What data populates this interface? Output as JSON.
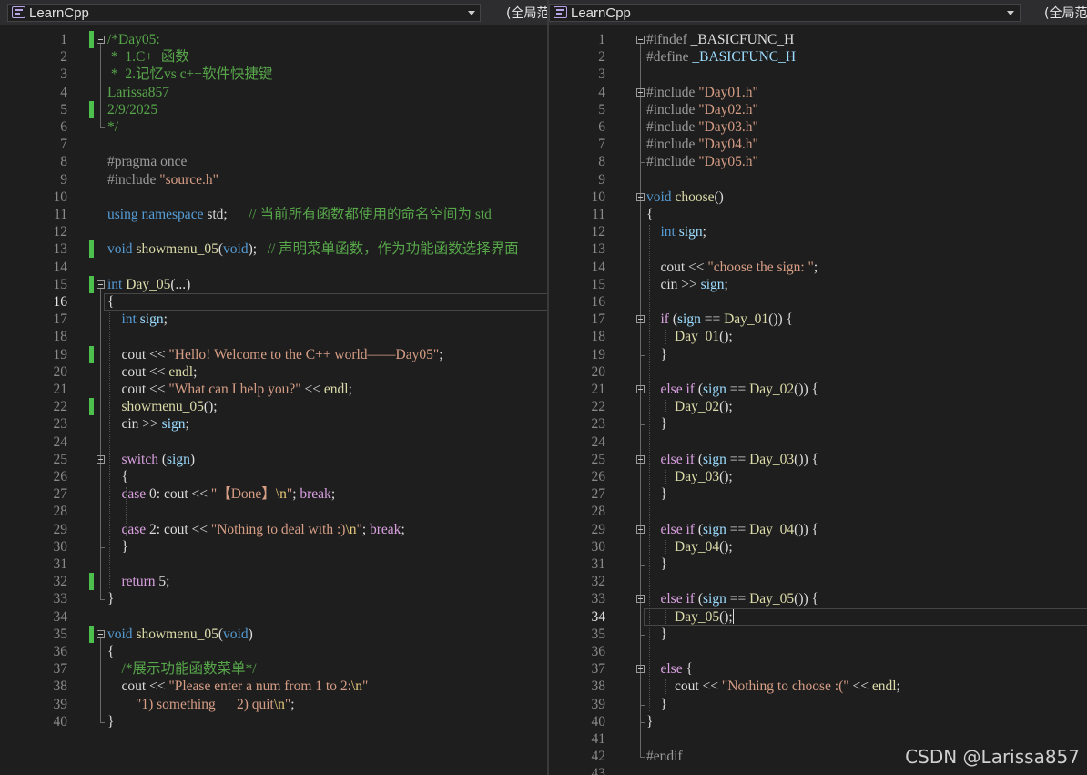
{
  "left_pane": {
    "project": "LearnCpp",
    "scope": "(全局范",
    "current_line": 16,
    "lines": [
      {
        "n": "1",
        "t": [
          [
            "c",
            "/*Day05:"
          ]
        ]
      },
      {
        "n": "2",
        "t": [
          [
            "c",
            " *  1.C++函数"
          ]
        ]
      },
      {
        "n": "3",
        "t": [
          [
            "c",
            " *  2.记忆vs c++软件快捷键"
          ]
        ]
      },
      {
        "n": "4",
        "t": [
          [
            "c",
            "Larissa857"
          ]
        ]
      },
      {
        "n": "5",
        "t": [
          [
            "c",
            "2/9/2025"
          ]
        ]
      },
      {
        "n": "6",
        "t": [
          [
            "c",
            "*/"
          ]
        ]
      },
      {
        "n": "7",
        "t": []
      },
      {
        "n": "8",
        "t": [
          [
            "p",
            "#pragma once"
          ]
        ]
      },
      {
        "n": "9",
        "t": [
          [
            "p",
            "#include "
          ],
          [
            "s",
            "\"source.h\""
          ]
        ]
      },
      {
        "n": "10",
        "t": []
      },
      {
        "n": "11",
        "t": [
          [
            "k",
            "using namespace "
          ],
          [
            "n",
            "std;      "
          ],
          [
            "c",
            "// 当前所有函数都使用的命名空间为 std"
          ]
        ]
      },
      {
        "n": "12",
        "t": []
      },
      {
        "n": "13",
        "t": [
          [
            "k",
            "void "
          ],
          [
            "f",
            "showmenu_05"
          ],
          [
            "n",
            "("
          ],
          [
            "k",
            "void"
          ],
          [
            "n",
            ");   "
          ],
          [
            "c",
            "// 声明菜单函数，作为功能函数选择界面"
          ]
        ]
      },
      {
        "n": "14",
        "t": []
      },
      {
        "n": "15",
        "t": [
          [
            "k",
            "int "
          ],
          [
            "f",
            "Day_05"
          ],
          [
            "n",
            "(...)"
          ]
        ]
      },
      {
        "n": "16",
        "t": [
          [
            "n",
            "{"
          ]
        ]
      },
      {
        "n": "17",
        "t": [
          [
            "n",
            "    "
          ],
          [
            "k",
            "int "
          ],
          [
            "v",
            "sign"
          ],
          [
            "n",
            ";"
          ]
        ]
      },
      {
        "n": "18",
        "t": []
      },
      {
        "n": "19",
        "t": [
          [
            "n",
            "    cout << "
          ],
          [
            "s",
            "\"Hello! Welcome to the C++ world——Day05\""
          ],
          [
            "n",
            ";"
          ]
        ]
      },
      {
        "n": "20",
        "t": [
          [
            "n",
            "    cout << "
          ],
          [
            "f",
            "endl"
          ],
          [
            "n",
            ";"
          ]
        ]
      },
      {
        "n": "21",
        "t": [
          [
            "n",
            "    cout << "
          ],
          [
            "s",
            "\"What can I help you?\""
          ],
          [
            "n",
            " << "
          ],
          [
            "f",
            "endl"
          ],
          [
            "n",
            ";"
          ]
        ]
      },
      {
        "n": "22",
        "t": [
          [
            "n",
            "    "
          ],
          [
            "f",
            "showmenu_05"
          ],
          [
            "n",
            "();"
          ]
        ]
      },
      {
        "n": "23",
        "t": [
          [
            "n",
            "    cin >> "
          ],
          [
            "v",
            "sign"
          ],
          [
            "n",
            ";"
          ]
        ]
      },
      {
        "n": "24",
        "t": []
      },
      {
        "n": "25",
        "t": [
          [
            "n",
            "    "
          ],
          [
            "r",
            "switch "
          ],
          [
            "n",
            "("
          ],
          [
            "v",
            "sign"
          ],
          [
            "n",
            ")"
          ]
        ]
      },
      {
        "n": "26",
        "t": [
          [
            "n",
            "    {"
          ]
        ]
      },
      {
        "n": "27",
        "t": [
          [
            "n",
            "    "
          ],
          [
            "r",
            "case "
          ],
          [
            "n",
            "0: cout << "
          ],
          [
            "s",
            "\"【Done】"
          ],
          [
            "e",
            "\\n"
          ],
          [
            "s",
            "\""
          ],
          [
            "n",
            "; "
          ],
          [
            "r",
            "break"
          ],
          [
            "n",
            ";"
          ]
        ]
      },
      {
        "n": "28",
        "t": []
      },
      {
        "n": "29",
        "t": [
          [
            "n",
            "    "
          ],
          [
            "r",
            "case "
          ],
          [
            "n",
            "2: cout << "
          ],
          [
            "s",
            "\"Nothing to deal with :)"
          ],
          [
            "e",
            "\\n"
          ],
          [
            "s",
            "\""
          ],
          [
            "n",
            "; "
          ],
          [
            "r",
            "break"
          ],
          [
            "n",
            ";"
          ]
        ]
      },
      {
        "n": "30",
        "t": [
          [
            "n",
            "    }"
          ]
        ]
      },
      {
        "n": "31",
        "t": []
      },
      {
        "n": "32",
        "t": [
          [
            "n",
            "    "
          ],
          [
            "r",
            "return "
          ],
          [
            "n",
            "5;"
          ]
        ]
      },
      {
        "n": "33",
        "t": [
          [
            "n",
            "}"
          ]
        ]
      },
      {
        "n": "34",
        "t": []
      },
      {
        "n": "35",
        "t": [
          [
            "k",
            "void "
          ],
          [
            "f",
            "showmenu_05"
          ],
          [
            "n",
            "("
          ],
          [
            "k",
            "void"
          ],
          [
            "n",
            ")"
          ]
        ]
      },
      {
        "n": "36",
        "t": [
          [
            "n",
            "{"
          ]
        ]
      },
      {
        "n": "37",
        "t": [
          [
            "n",
            "    "
          ],
          [
            "c",
            "/*展示功能函数菜单*/"
          ]
        ]
      },
      {
        "n": "38",
        "t": [
          [
            "n",
            "    cout << "
          ],
          [
            "s",
            "\"Please enter a num from 1 to 2:"
          ],
          [
            "e",
            "\\n"
          ],
          [
            "s",
            "\""
          ]
        ]
      },
      {
        "n": "39",
        "t": [
          [
            "s",
            "        \"1) something      2) quit"
          ],
          [
            "e",
            "\\n"
          ],
          [
            "s",
            "\""
          ],
          [
            "n",
            ";"
          ]
        ]
      },
      {
        "n": "40",
        "t": [
          [
            "n",
            "}"
          ]
        ]
      }
    ]
  },
  "right_pane": {
    "project": "LearnCpp",
    "scope": "(全局范",
    "current_line": 34,
    "lines": [
      {
        "n": "1",
        "t": [
          [
            "p",
            "#ifndef "
          ],
          [
            "n",
            "_BASICFUNC_H"
          ]
        ]
      },
      {
        "n": "2",
        "t": [
          [
            "p",
            "#define "
          ],
          [
            "v",
            "_BASICFUNC_H"
          ]
        ]
      },
      {
        "n": "3",
        "t": []
      },
      {
        "n": "4",
        "t": [
          [
            "p",
            "#include "
          ],
          [
            "s",
            "\"Day01.h\""
          ]
        ]
      },
      {
        "n": "5",
        "t": [
          [
            "p",
            "#include "
          ],
          [
            "s",
            "\"Day02.h\""
          ]
        ]
      },
      {
        "n": "6",
        "t": [
          [
            "p",
            "#include "
          ],
          [
            "s",
            "\"Day03.h\""
          ]
        ]
      },
      {
        "n": "7",
        "t": [
          [
            "p",
            "#include "
          ],
          [
            "s",
            "\"Day04.h\""
          ]
        ]
      },
      {
        "n": "8",
        "t": [
          [
            "p",
            "#include "
          ],
          [
            "s",
            "\"Day05.h\""
          ]
        ]
      },
      {
        "n": "9",
        "t": []
      },
      {
        "n": "10",
        "t": [
          [
            "k",
            "void "
          ],
          [
            "f",
            "choose"
          ],
          [
            "n",
            "()"
          ]
        ]
      },
      {
        "n": "11",
        "t": [
          [
            "n",
            "{"
          ]
        ]
      },
      {
        "n": "12",
        "t": [
          [
            "n",
            "    "
          ],
          [
            "k",
            "int "
          ],
          [
            "v",
            "sign"
          ],
          [
            "n",
            ";"
          ]
        ]
      },
      {
        "n": "13",
        "t": []
      },
      {
        "n": "14",
        "t": [
          [
            "n",
            "    cout << "
          ],
          [
            "s",
            "\"choose the sign: \""
          ],
          [
            "n",
            ";"
          ]
        ]
      },
      {
        "n": "15",
        "t": [
          [
            "n",
            "    cin >> "
          ],
          [
            "v",
            "sign"
          ],
          [
            "n",
            ";"
          ]
        ]
      },
      {
        "n": "16",
        "t": []
      },
      {
        "n": "17",
        "t": [
          [
            "n",
            "    "
          ],
          [
            "r",
            "if "
          ],
          [
            "n",
            "("
          ],
          [
            "v",
            "sign"
          ],
          [
            "n",
            " == "
          ],
          [
            "f",
            "Day_01"
          ],
          [
            "n",
            "()) {"
          ]
        ]
      },
      {
        "n": "18",
        "t": [
          [
            "n",
            "        "
          ],
          [
            "f",
            "Day_01"
          ],
          [
            "n",
            "();"
          ]
        ]
      },
      {
        "n": "19",
        "t": [
          [
            "n",
            "    }"
          ]
        ]
      },
      {
        "n": "20",
        "t": []
      },
      {
        "n": "21",
        "t": [
          [
            "n",
            "    "
          ],
          [
            "r",
            "else if "
          ],
          [
            "n",
            "("
          ],
          [
            "v",
            "sign"
          ],
          [
            "n",
            " == "
          ],
          [
            "f",
            "Day_02"
          ],
          [
            "n",
            "()) {"
          ]
        ]
      },
      {
        "n": "22",
        "t": [
          [
            "n",
            "        "
          ],
          [
            "f",
            "Day_02"
          ],
          [
            "n",
            "();"
          ]
        ]
      },
      {
        "n": "23",
        "t": [
          [
            "n",
            "    }"
          ]
        ]
      },
      {
        "n": "24",
        "t": []
      },
      {
        "n": "25",
        "t": [
          [
            "n",
            "    "
          ],
          [
            "r",
            "else if "
          ],
          [
            "n",
            "("
          ],
          [
            "v",
            "sign"
          ],
          [
            "n",
            " == "
          ],
          [
            "f",
            "Day_03"
          ],
          [
            "n",
            "()) {"
          ]
        ]
      },
      {
        "n": "26",
        "t": [
          [
            "n",
            "        "
          ],
          [
            "f",
            "Day_03"
          ],
          [
            "n",
            "();"
          ]
        ]
      },
      {
        "n": "27",
        "t": [
          [
            "n",
            "    }"
          ]
        ]
      },
      {
        "n": "28",
        "t": []
      },
      {
        "n": "29",
        "t": [
          [
            "n",
            "    "
          ],
          [
            "r",
            "else if "
          ],
          [
            "n",
            "("
          ],
          [
            "v",
            "sign"
          ],
          [
            "n",
            " == "
          ],
          [
            "f",
            "Day_04"
          ],
          [
            "n",
            "()) {"
          ]
        ]
      },
      {
        "n": "30",
        "t": [
          [
            "n",
            "        "
          ],
          [
            "f",
            "Day_04"
          ],
          [
            "n",
            "();"
          ]
        ]
      },
      {
        "n": "31",
        "t": [
          [
            "n",
            "    }"
          ]
        ]
      },
      {
        "n": "32",
        "t": []
      },
      {
        "n": "33",
        "t": [
          [
            "n",
            "    "
          ],
          [
            "r",
            "else if "
          ],
          [
            "n",
            "("
          ],
          [
            "v",
            "sign"
          ],
          [
            "n",
            " == "
          ],
          [
            "f",
            "Day_05"
          ],
          [
            "n",
            "()) {"
          ]
        ]
      },
      {
        "n": "34",
        "t": [
          [
            "n",
            "        "
          ],
          [
            "f",
            "Day_05"
          ],
          [
            "n",
            "();"
          ]
        ]
      },
      {
        "n": "35",
        "t": [
          [
            "n",
            "    }"
          ]
        ]
      },
      {
        "n": "36",
        "t": []
      },
      {
        "n": "37",
        "t": [
          [
            "n",
            "    "
          ],
          [
            "r",
            "else "
          ],
          [
            "n",
            "{"
          ]
        ]
      },
      {
        "n": "38",
        "t": [
          [
            "n",
            "        cout << "
          ],
          [
            "s",
            "\"Nothing to choose :(\""
          ],
          [
            "n",
            " << "
          ],
          [
            "f",
            "endl"
          ],
          [
            "n",
            ";"
          ]
        ]
      },
      {
        "n": "39",
        "t": [
          [
            "n",
            "    }"
          ]
        ]
      },
      {
        "n": "40",
        "t": [
          [
            "n",
            "}"
          ]
        ]
      },
      {
        "n": "41",
        "t": []
      },
      {
        "n": "42",
        "t": [
          [
            "p",
            "#endif"
          ]
        ]
      },
      {
        "n": "43",
        "t": []
      }
    ]
  },
  "watermark": "CSDN @Larissa857",
  "colors": {
    "background": "#1e1e1e",
    "comment": "#57a64a",
    "keyword": "#569cd6",
    "function": "#dcdcaa",
    "string": "#d69d85",
    "variable": "#9cdcfe",
    "preprocessor": "#9b9b9b",
    "control": "#d8a0df",
    "escape": "#e7c97a",
    "change_marker": "#4cbf4c"
  },
  "icons": [
    "project-icon",
    "dropdown-arrow-icon",
    "fold-toggle-icon"
  ]
}
